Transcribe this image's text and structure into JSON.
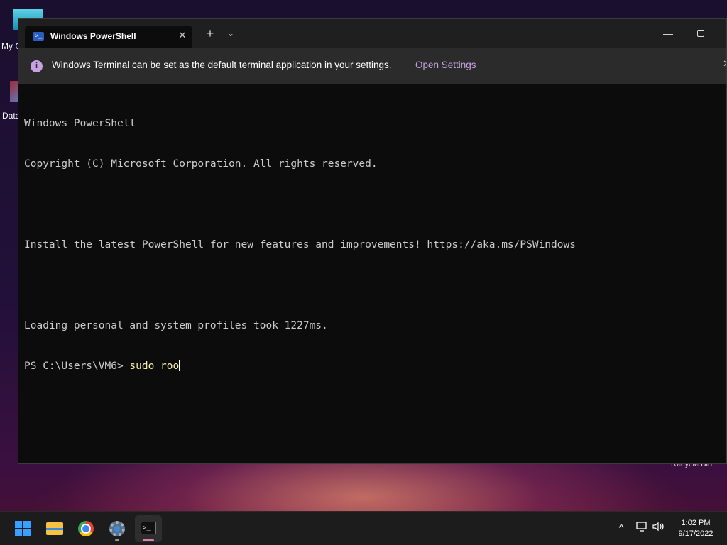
{
  "desktop": {
    "icons": [
      {
        "label": "My C"
      },
      {
        "label": "Data"
      }
    ],
    "recycle_bin_label": "Recycle Bin"
  },
  "window": {
    "tab_title": "Windows PowerShell",
    "tab_close": "✕",
    "new_tab": "+",
    "tab_menu": "⌄",
    "minimize": "—"
  },
  "infobar": {
    "icon": "i",
    "message": "Windows Terminal can be set as the default terminal application in your settings.",
    "action": "Open Settings",
    "close": "✕"
  },
  "console": {
    "lines": [
      "Windows PowerShell",
      "Copyright (C) Microsoft Corporation. All rights reserved.",
      "",
      "Install the latest PowerShell for new features and improvements! https://aka.ms/PSWindows",
      "",
      "Loading personal and system profiles took 1227ms."
    ],
    "prompt": "PS C:\\Users\\VM6> ",
    "command": "sudo roo"
  },
  "taskbar": {
    "apps": [
      {
        "name": "start",
        "icon": "windows-logo-icon"
      },
      {
        "name": "file-explorer",
        "icon": "folder-icon"
      },
      {
        "name": "chrome",
        "icon": "chrome-icon"
      },
      {
        "name": "settings",
        "icon": "gear-icon"
      },
      {
        "name": "terminal",
        "icon": "terminal-icon"
      }
    ],
    "tray": {
      "chevron": "^",
      "time": "1:02 PM",
      "date": "9/17/2022"
    }
  },
  "colors": {
    "accent": "#c6a3e0",
    "terminal_bg": "#0c0c0c",
    "command_text": "#f9f1a5",
    "console_text": "#cccccc"
  }
}
